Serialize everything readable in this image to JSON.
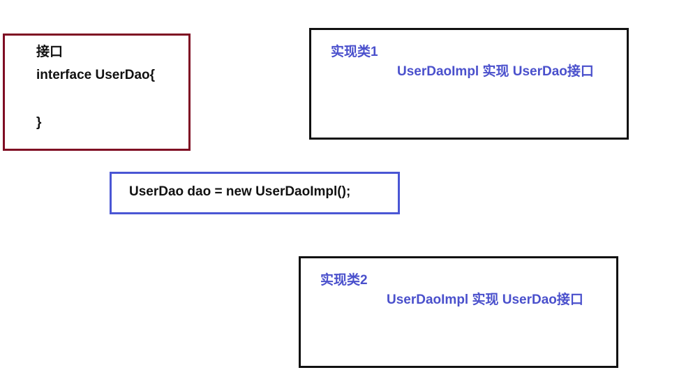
{
  "interface_box": {
    "heading": "接口",
    "declaration": "interface UserDao{",
    "closing": "}"
  },
  "impl1_box": {
    "title": "实现类1",
    "description": "UserDaoImpl 实现 UserDao接口"
  },
  "assignment_box": {
    "code": "UserDao dao = new UserDaoImpl();"
  },
  "impl2_box": {
    "title": "实现类2",
    "description": "UserDaoImpl 实现 UserDao接口"
  },
  "colors": {
    "interface_border": "#7f0d23",
    "impl_border": "#111111",
    "assignment_border": "#4a56d4",
    "impl_text": "#4a50cc",
    "code_text": "#111111"
  }
}
